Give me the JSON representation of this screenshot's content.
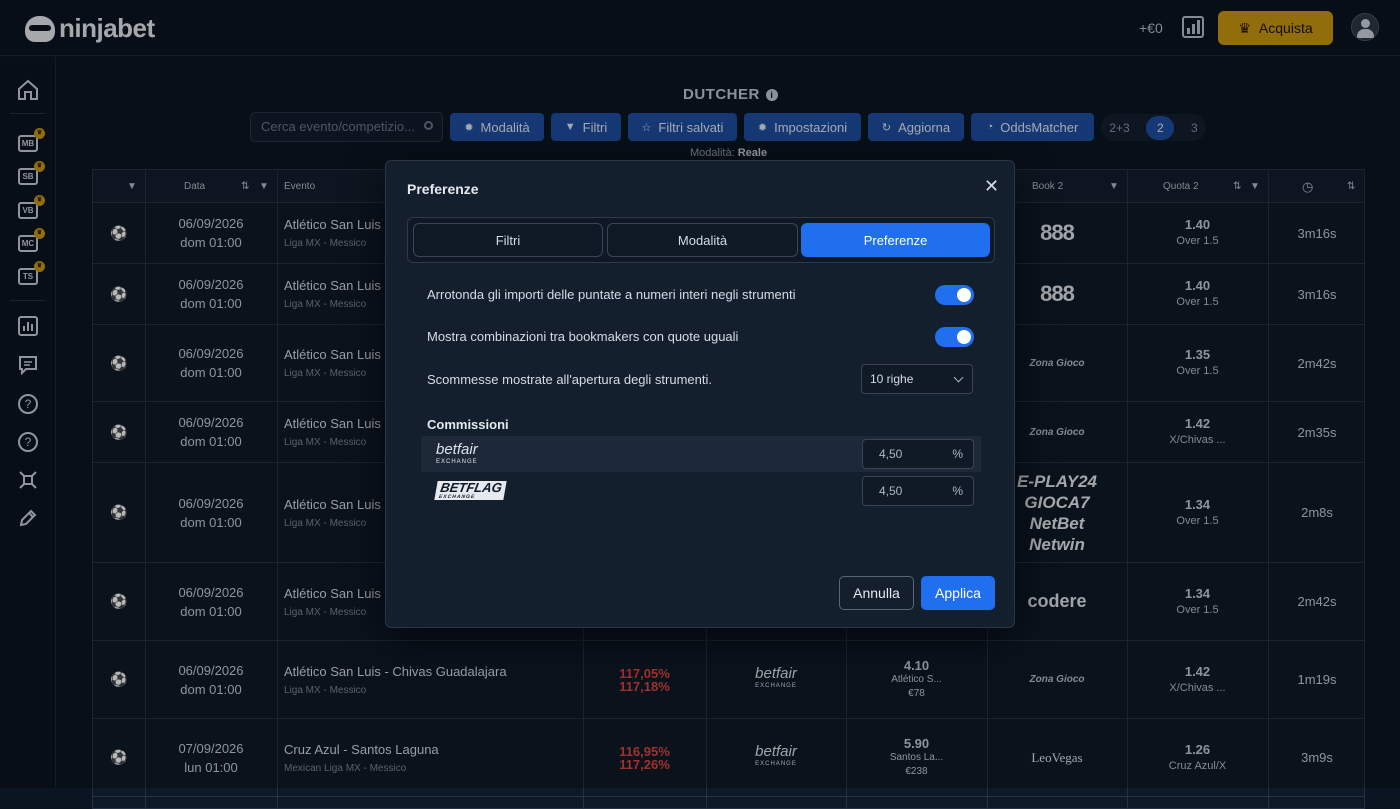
{
  "topbar": {
    "logo_text": "ninjabet",
    "balance": "+€0",
    "buy_label": "Acquista"
  },
  "sidebar": {
    "items": [
      "MB",
      "SB",
      "VB",
      "MC",
      "TS"
    ],
    "crown": "♛"
  },
  "page": {
    "title": "DUTCHER"
  },
  "toolbar": {
    "search_placeholder": "Cerca evento/competizio...",
    "modalita": "Modalità",
    "filtri": "Filtri",
    "filtri_salvati": "Filtri salvati",
    "impostazioni": "Impostazioni",
    "aggiorna": "Aggiorna",
    "oddsmatcher": "OddsMatcher",
    "seg": [
      "2+3",
      "2",
      "3"
    ],
    "mode_label": "Modalità:",
    "mode_value": "Reale"
  },
  "table": {
    "headers": {
      "data": "Data",
      "evento": "Evento",
      "book2": "Book 2",
      "quota2": "Quota 2"
    },
    "rows": [
      {
        "date": "06/09/2026",
        "time": "dom 01:00",
        "event": "Atlético San Luis -",
        "league": "Liga MX - Messico",
        "book2": "888",
        "q2": "1.40",
        "q2sub": "Over 1.5",
        "tm": "3m16s"
      },
      {
        "date": "06/09/2026",
        "time": "dom 01:00",
        "event": "Atlético San Luis -",
        "league": "Liga MX - Messico",
        "book2": "888",
        "q2": "1.40",
        "q2sub": "Over 1.5",
        "tm": "3m16s"
      },
      {
        "date": "06/09/2026",
        "time": "dom 01:00",
        "event": "Atlético San Luis -",
        "league": "Liga MX - Messico",
        "book2": "Zona Gioco",
        "q2": "1.35",
        "q2sub": "Over 1.5",
        "tm": "2m42s"
      },
      {
        "date": "06/09/2026",
        "time": "dom 01:00",
        "event": "Atlético San Luis -",
        "league": "Liga MX - Messico",
        "book2": "Zona Gioco",
        "q2": "1.42",
        "q2sub": "X/Chivas ...",
        "tm": "2m35s"
      },
      {
        "date": "06/09/2026",
        "time": "dom 01:00",
        "event": "Atlético San Luis -",
        "league": "Liga MX - Messico",
        "book2_stack": [
          "E-PLAY24",
          "GIOCA7",
          "NetBet",
          "Netwin"
        ],
        "q2": "1.34",
        "q2sub": "Over 1.5",
        "tm": "2m8s"
      },
      {
        "date": "06/09/2026",
        "time": "dom 01:00",
        "event": "Atlético San Luis -",
        "league": "Liga MX - Messico",
        "book2": "codere",
        "q2": "1.34",
        "q2sub": "Over 1.5",
        "tm": "2m42s"
      },
      {
        "date": "06/09/2026",
        "time": "dom 01:00",
        "event": "Atlético San Luis - Chivas Guadalajara",
        "league": "Liga MX - Messico",
        "pct1": "117,05%",
        "pct2": "117,18%",
        "book1": "betfair",
        "book1sub": "EXCHANGE",
        "q1": "4.10",
        "q1sub": "Atlético S...",
        "q1amt": "€78",
        "book2": "Zona Gioco",
        "q2": "1.42",
        "q2sub": "X/Chivas ...",
        "tm": "1m19s"
      },
      {
        "date": "07/09/2026",
        "time": "lun 01:00",
        "event": "Cruz Azul - Santos Laguna",
        "league": "Mexican Liga MX - Messico",
        "pct1": "116,95%",
        "pct2": "117,26%",
        "book1": "betfair",
        "book1sub": "EXCHANGE",
        "q1": "5.90",
        "q1sub": "Santos La...",
        "q1amt": "€238",
        "book2": "LeoVegas",
        "q2": "1.26",
        "q2sub": "Cruz Azul/X",
        "tm": "3m9s"
      }
    ]
  },
  "modal": {
    "title": "Preferenze",
    "tabs": [
      "Filtri",
      "Modalità",
      "Preferenze"
    ],
    "opt_round": "Arrotonda gli importi delle puntate a numeri interi negli strumenti",
    "opt_combo": "Mostra combinazioni tra bookmakers con quote uguali",
    "opt_rows": "Scommesse mostrate all'apertura degli strumenti.",
    "rows_value": "10 righe",
    "commissioni": "Commissioni",
    "betfair_name": "betfair",
    "betfair_sub": "EXCHANGE",
    "betfair_value": "4,50",
    "betflag_name": "BETFLAG",
    "betflag_sub": "EXCHANGE",
    "betflag_value": "4,50",
    "percent": "%",
    "cancel": "Annulla",
    "apply": "Applica"
  },
  "colors": {
    "accent": "#1f6fee",
    "button": "#1f4ea3",
    "gold": "#c99710",
    "loss": "#e0453f"
  }
}
